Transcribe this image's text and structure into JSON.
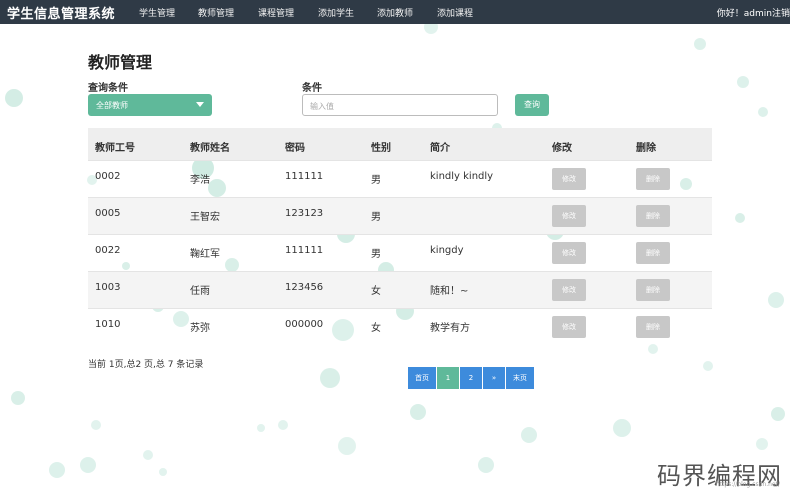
{
  "app": {
    "title": "学生信息管理系统",
    "nav": [
      "学生管理",
      "教师管理",
      "课程管理",
      "添加学生",
      "添加教师",
      "添加课程"
    ],
    "greeting": "你好！admin注销"
  },
  "page": {
    "title": "教师管理",
    "filter_label": "查询条件",
    "filter_value": "全部教师",
    "condition_label": "条件",
    "condition_placeholder": "输入值",
    "query_button": "查询"
  },
  "table": {
    "columns": [
      "教师工号",
      "教师姓名",
      "密码",
      "性别",
      "简介",
      "修改",
      "删除"
    ],
    "edit_label": "修改",
    "delete_label": "删除",
    "rows": [
      {
        "id": "0002",
        "name": "李浩",
        "password": "111111",
        "gender": "男",
        "intro": "kindly kindly"
      },
      {
        "id": "0005",
        "name": "王智宏",
        "password": "123123",
        "gender": "男",
        "intro": ""
      },
      {
        "id": "0022",
        "name": "鞠红军",
        "password": "111111",
        "gender": "男",
        "intro": "kingdy"
      },
      {
        "id": "1003",
        "name": "任雨",
        "password": "123456",
        "gender": "女",
        "intro": "随和！~"
      },
      {
        "id": "1010",
        "name": "苏弥",
        "password": "000000",
        "gender": "女",
        "intro": "教学有方"
      }
    ]
  },
  "footer": {
    "summary": "当前 1页,总2 页,总 7 条记录"
  },
  "pagination": [
    "首页",
    "1",
    "2",
    "»",
    "末页"
  ],
  "colors": {
    "navbar": "#2f3a46",
    "accent": "#5fb99a",
    "pager": "#3d8bdc",
    "pager_active": "#5fb99a",
    "disabled_button": "#c8c8c8"
  },
  "watermark": {
    "text": "码界编程网",
    "sub": "https://blog.csdn.net/"
  }
}
